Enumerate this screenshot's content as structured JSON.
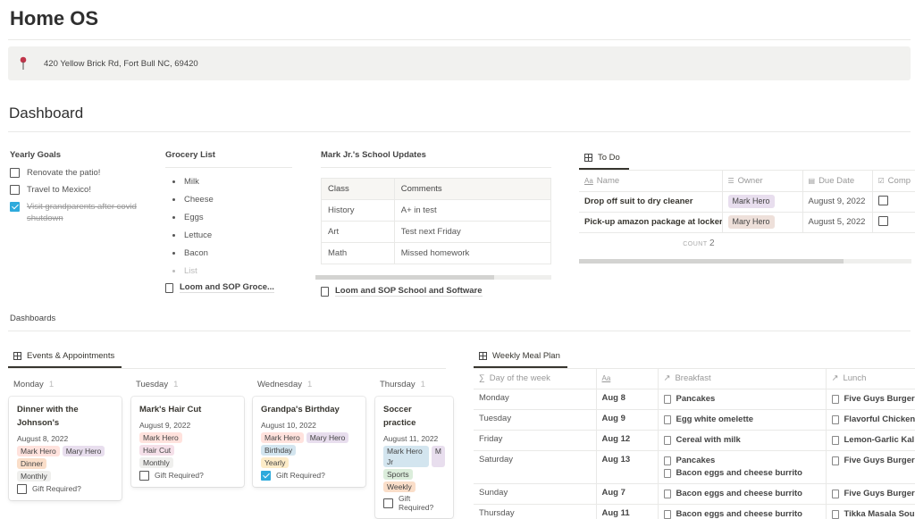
{
  "page": {
    "title": "Home OS",
    "address": "420 Yellow Brick Rd, Fort Bull NC, 69420",
    "address_icon": "pin-icon",
    "section_title": "Dashboard"
  },
  "yearly_goals": {
    "title": "Yearly Goals",
    "items": [
      {
        "label": "Renovate the patio!",
        "checked": false
      },
      {
        "label": "Travel to Mexico!",
        "checked": false
      },
      {
        "label": "Visit grandparents after covid shutdown",
        "checked": true
      }
    ]
  },
  "grocery": {
    "title": "Grocery List",
    "items": [
      "Milk",
      "Cheese",
      "Eggs",
      "Lettuce",
      "Bacon"
    ],
    "placeholder": "List",
    "link": "Loom and SOP Groce..."
  },
  "school": {
    "title": "Mark Jr.'s School Updates",
    "headers": [
      "Class",
      "Comments"
    ],
    "rows": [
      [
        "History",
        "A+ in test"
      ],
      [
        "Art",
        "Test next Friday"
      ],
      [
        "Math",
        "Missed homework"
      ]
    ],
    "link": "Loom and SOP School and Software"
  },
  "todo": {
    "tab": "To Do",
    "headers": [
      "Name",
      "Owner",
      "Due Date",
      "Comp"
    ],
    "header_icons": [
      "text-icon",
      "list-icon",
      "calendar-icon",
      "checkbox-icon"
    ],
    "rows": [
      {
        "name": "Drop off suit to dry cleaner",
        "owner": "Mark Hero",
        "owner_color": "#e8deee",
        "due": "August 9, 2022",
        "complete": false
      },
      {
        "name": "Pick-up amazon package at locker",
        "owner": "Mary Hero",
        "owner_color": "#eee0da",
        "due": "August 5, 2022",
        "complete": false
      }
    ],
    "count_label": "COUNT",
    "count": "2"
  },
  "dashboards": {
    "title": "Dashboards"
  },
  "events": {
    "tab": "Events & Appointments",
    "columns": [
      {
        "day": "Monday",
        "count": "1",
        "card": {
          "title": "Dinner with the Johnson's",
          "date": "August 8, 2022",
          "tag_rows": [
            [
              {
                "label": "Mark Hero",
                "color": "#ffe2dd"
              },
              {
                "label": "Mary Hero",
                "color": "#e8deee"
              }
            ],
            [
              {
                "label": "Dinner",
                "color": "#fadec9"
              }
            ],
            [
              {
                "label": "Monthly",
                "color": "#efefed"
              }
            ]
          ],
          "gift_label": "Gift Required?",
          "gift": false
        }
      },
      {
        "day": "Tuesday",
        "count": "1",
        "card": {
          "title": "Mark's Hair Cut",
          "date": "August 9, 2022",
          "tag_rows": [
            [
              {
                "label": "Mark Hero",
                "color": "#ffe2dd"
              }
            ],
            [
              {
                "label": "Hair Cut",
                "color": "#f5e0e9"
              }
            ],
            [
              {
                "label": "Monthly",
                "color": "#efefed"
              }
            ]
          ],
          "gift_label": "Gift Required?",
          "gift": false
        }
      },
      {
        "day": "Wednesday",
        "count": "1",
        "card": {
          "title": "Grandpa's Birthday",
          "date": "August 10, 2022",
          "tag_rows": [
            [
              {
                "label": "Mark Hero",
                "color": "#ffe2dd"
              },
              {
                "label": "Mary Hero",
                "color": "#e8deee"
              }
            ],
            [
              {
                "label": "Birthday",
                "color": "#d3e5ef"
              }
            ],
            [
              {
                "label": "Yearly",
                "color": "#fdecc8"
              }
            ]
          ],
          "gift_label": "Gift Required?",
          "gift": true
        }
      },
      {
        "day": "Thursday",
        "count": "1",
        "card": {
          "title": "Soccer practice",
          "date": "August 11, 2022",
          "tag_rows": [
            [
              {
                "label": "Mark Hero Jr",
                "color": "#d3e5ef"
              },
              {
                "label": "M",
                "color": "#e8deee"
              }
            ],
            [
              {
                "label": "Sports",
                "color": "#dbeddb"
              }
            ],
            [
              {
                "label": "Weekly",
                "color": "#fadec9"
              }
            ]
          ],
          "gift_label": "Gift Required?",
          "gift": false
        }
      }
    ]
  },
  "meal_plan": {
    "tab": "Weekly Meal Plan",
    "headers": [
      "Day of the week",
      "Aa",
      "Breakfast",
      "Lunch"
    ],
    "header_icons": [
      "sigma-icon",
      "text-icon",
      "relation-arrow-icon",
      "relation-arrow-icon"
    ],
    "rows": [
      {
        "day": "Monday",
        "date": "Aug 8",
        "breakfast": [
          "Pancakes"
        ],
        "lunch": [
          "Five Guys Burger"
        ]
      },
      {
        "day": "Tuesday",
        "date": "Aug 9",
        "breakfast": [
          "Egg white omelette"
        ],
        "lunch": [
          "Flavorful Chicken"
        ]
      },
      {
        "day": "Friday",
        "date": "Aug 12",
        "breakfast": [
          "Cereal with milk"
        ],
        "lunch": [
          "Lemon-Garlic Kal"
        ]
      },
      {
        "day": "Saturday",
        "date": "Aug 13",
        "breakfast": [
          "Pancakes",
          "Bacon eggs and cheese burrito"
        ],
        "lunch": [
          "Five Guys Burger"
        ]
      },
      {
        "day": "Sunday",
        "date": "Aug 7",
        "breakfast": [
          "Bacon eggs and cheese burrito"
        ],
        "lunch": [
          "Five Guys Burger"
        ]
      },
      {
        "day": "Thursday",
        "date": "Aug 11",
        "breakfast": [
          "Bacon eggs and cheese burrito"
        ],
        "lunch": [
          "Tikka Masala Sou"
        ]
      }
    ]
  },
  "colors": {
    "checkbox_checked": "#2eaadc",
    "pin": "#c0354a"
  }
}
